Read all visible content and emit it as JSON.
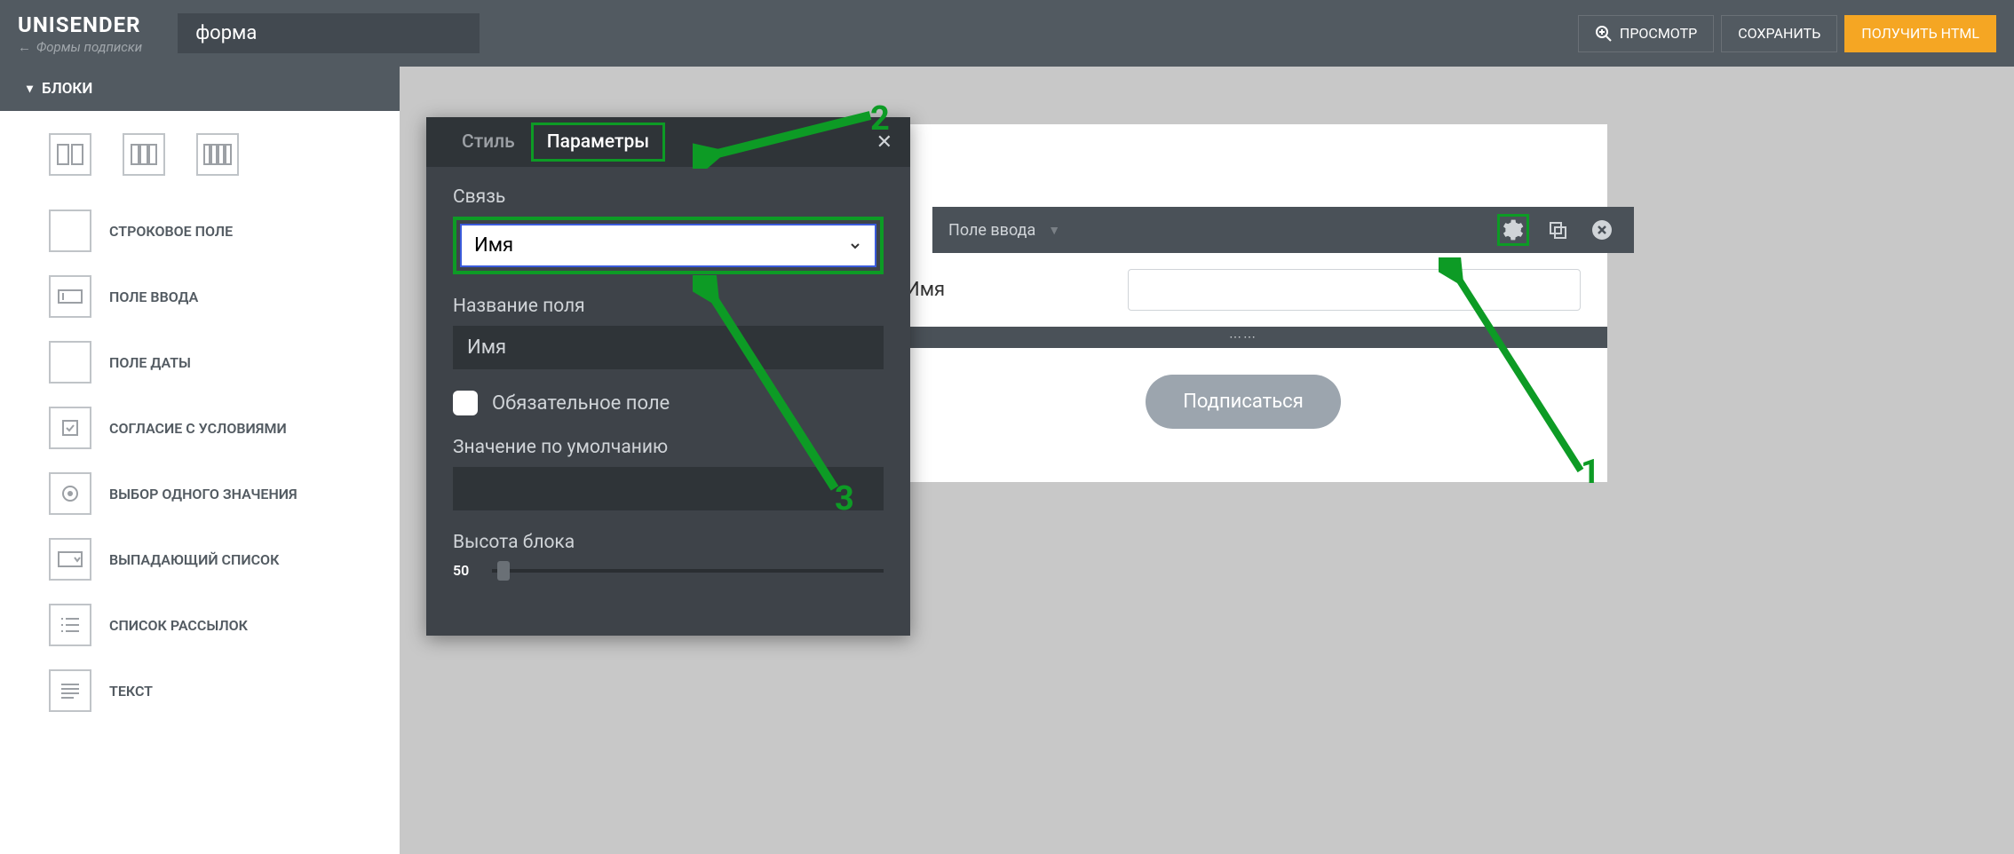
{
  "header": {
    "logo": "UNISENDER",
    "breadcrumb": "Формы подписки",
    "form_name": "форма",
    "preview_label": "ПРОСМОТР",
    "save_label": "СОХРАНИТЬ",
    "get_html_label": "ПОЛУЧИТЬ HTML"
  },
  "sidebar": {
    "title": "БЛОКИ",
    "items": [
      {
        "label": "СТРОКОВОЕ ПОЛЕ"
      },
      {
        "label": "ПОЛЕ ВВОДА"
      },
      {
        "label": "ПОЛЕ ДАТЫ"
      },
      {
        "label": "СОГЛАСИЕ С УСЛОВИЯМИ"
      },
      {
        "label": "ВЫБОР ОДНОГО ЗНАЧЕНИЯ"
      },
      {
        "label": "ВЫПАДАЮЩИЙ СПИСОК"
      },
      {
        "label": "СПИСОК РАССЫЛОК"
      },
      {
        "label": "ТЕКСТ"
      }
    ]
  },
  "panel": {
    "tab_style": "Стиль",
    "tab_params": "Параметры",
    "link_label": "Связь",
    "link_value": "Имя",
    "name_label": "Название поля",
    "name_value": "Имя",
    "required_label": "Обязательное поле",
    "default_label": "Значение по умолчанию",
    "default_value": "",
    "height_label": "Высота блока",
    "height_value": "50"
  },
  "canvas": {
    "toolbar_label": "Поле ввода",
    "field_label": "Имя",
    "subscribe_label": "Подписаться",
    "drag_dots": "⋯⋯"
  },
  "annotations": {
    "n1": "1",
    "n2": "2",
    "n3": "3"
  }
}
